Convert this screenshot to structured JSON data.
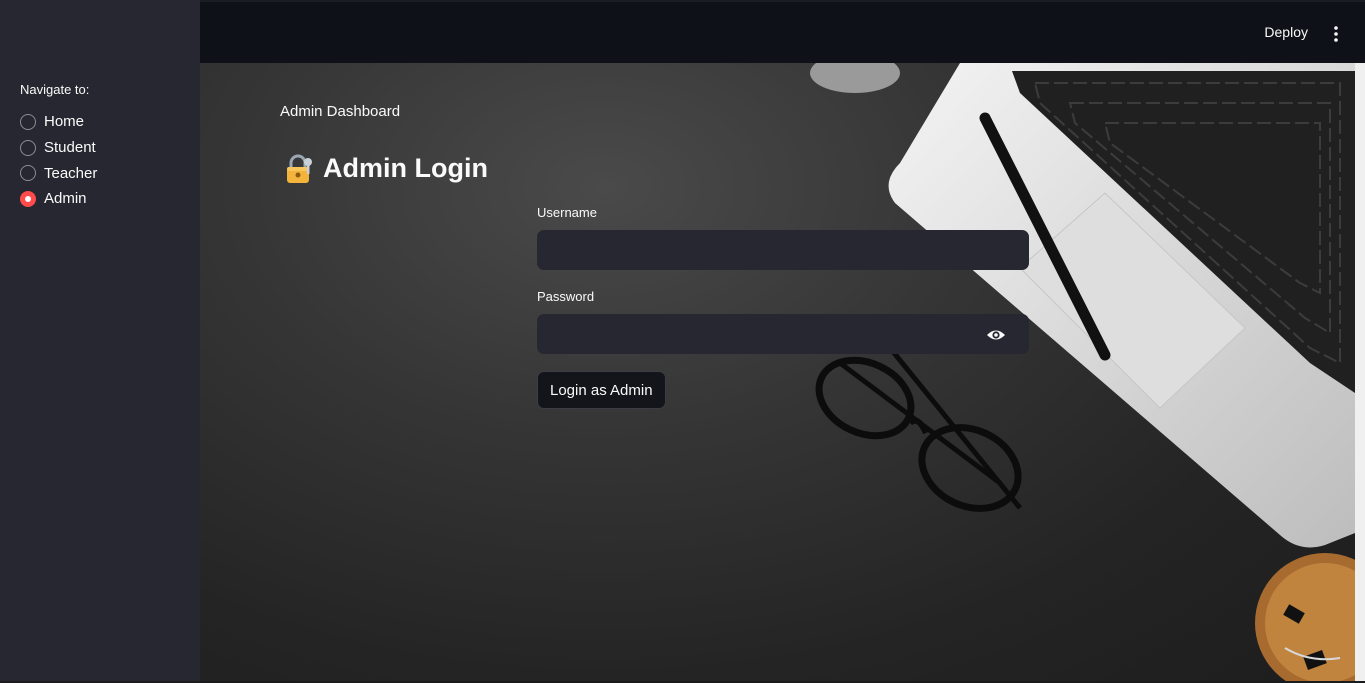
{
  "sidebar": {
    "nav_label": "Navigate to:",
    "options": [
      {
        "label": "Home",
        "selected": false
      },
      {
        "label": "Student",
        "selected": false
      },
      {
        "label": "Teacher",
        "selected": false
      },
      {
        "label": "Admin",
        "selected": true
      }
    ]
  },
  "header": {
    "deploy_label": "Deploy",
    "menu_icon": "vertical-dots-icon"
  },
  "main": {
    "subheading": "Admin Dashboard",
    "title": "Admin Login",
    "title_icon": "lock-with-key-icon",
    "username": {
      "label": "Username",
      "value": "",
      "placeholder": ""
    },
    "password": {
      "label": "Password",
      "value": "",
      "placeholder": "",
      "toggle_icon": "eye-icon"
    },
    "login_button": "Login as Admin"
  },
  "colors": {
    "accent": "#ff4b4b",
    "sidebar_bg": "#262730",
    "header_bg": "#0e1117",
    "input_bg": "#262730"
  }
}
